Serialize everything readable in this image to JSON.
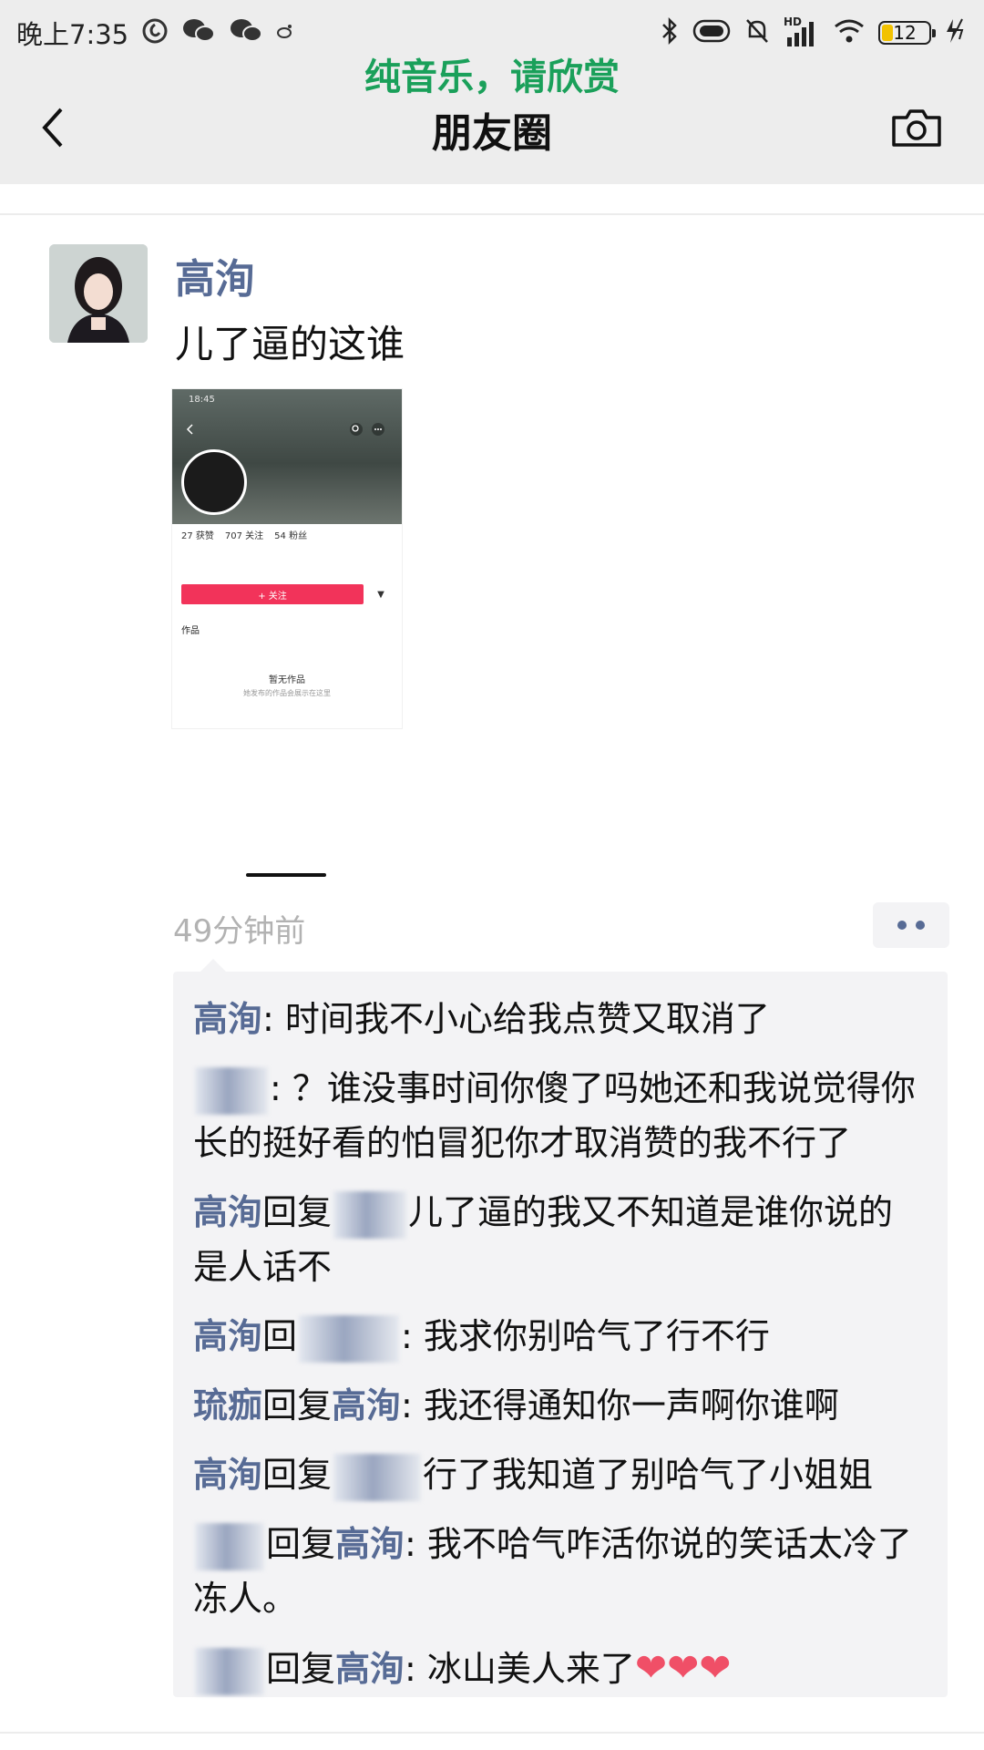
{
  "status_bar": {
    "time": "晚上7:35",
    "network_label": "HD",
    "battery": "12"
  },
  "header": {
    "caption": "纯音乐，请欣赏",
    "title": "朋友圈"
  },
  "post": {
    "author": "高洵",
    "text": "儿了逼的这谁",
    "image": {
      "status_time": "18:45",
      "stats": [
        "27 获赞",
        "707 关注",
        "54 粉丝"
      ],
      "follow_button": "+ 关注",
      "works_label": "作品",
      "empty_title": "暂无作品",
      "empty_subtitle": "她发布的作品会展示在这里"
    },
    "time": "49分钟前"
  },
  "comments": {
    "c1": {
      "author": "高洵",
      "text": ": 时间我不小心给我点赞又取消了"
    },
    "c2": {
      "text": ": ？谁没事时间你傻了吗她还和我说觉得你长的挺好看的怕冒犯你才取消赞的我不行了"
    },
    "c3": {
      "author": "高洵",
      "reply": "回复",
      "text": "儿了逼的我又不知道是谁你说的是人话不"
    },
    "c4": {
      "author": "高洵",
      "reply": "回",
      "text": ": 我求你别哈气了行不行"
    },
    "c5": {
      "author": "琉痂",
      "reply": "回复",
      "target": "高洵",
      "text": ": 我还得通知你一声啊你谁啊"
    },
    "c6": {
      "author": "高洵",
      "reply": "回复",
      "text": "行了我知道了别哈气了小姐姐"
    },
    "c7": {
      "reply": "回复",
      "target": "高洵",
      "text": ": 我不哈气咋活你说的笑话太冷了冻人。"
    },
    "c8": {
      "reply": "回复",
      "target": "高洵",
      "text": ": 冰山美人来了",
      "hearts": "❤❤❤"
    }
  }
}
